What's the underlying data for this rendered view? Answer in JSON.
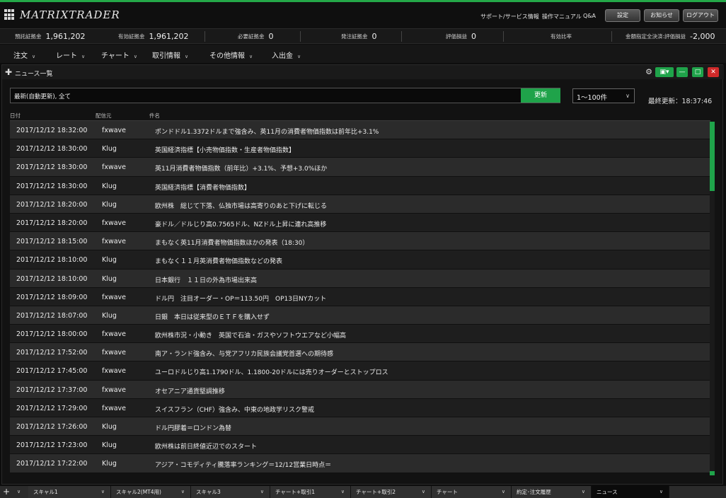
{
  "header": {
    "logo_text": "MATRIXTRADER",
    "links": [
      "サポート/サービス情報",
      "操作マニュアル",
      "Q&A"
    ],
    "buttons": [
      "設定",
      "お知らせ",
      "ログアウト"
    ]
  },
  "account": [
    {
      "label": "預託証拠金",
      "value": "1,961,202"
    },
    {
      "label": "有効証拠金",
      "value": "1,961,202"
    },
    {
      "label": "必要証拠金",
      "value": "0"
    },
    {
      "label": "発注証拠金",
      "value": "0"
    },
    {
      "label": "評価損益",
      "value": "0"
    },
    {
      "label": "有効比率",
      "value": ""
    },
    {
      "label": "金額指定全決済:評価損益",
      "value": "-2,000"
    }
  ],
  "menu": [
    "注文",
    "レート",
    "チャート",
    "取引情報",
    "その他情報",
    "入出金"
  ],
  "panel": {
    "title": "ニュース一覧",
    "filter_text": "最新(自動更新), 全て",
    "refresh_label": "更新",
    "range_value": "1～100件",
    "last_update": "最終更新：18:37:46",
    "columns": {
      "date": "日付",
      "source": "配信元",
      "subject": "件名"
    }
  },
  "news": [
    {
      "date": "2017/12/12 18:32:00",
      "source": "fxwave",
      "title": "ポンドドル1.3372ドルまで強含み、英11月の消費者物価指数は前年比+3.1%"
    },
    {
      "date": "2017/12/12 18:30:00",
      "source": "Klug",
      "title": "英国経済指標【小売物価指数・生産者物価指数】"
    },
    {
      "date": "2017/12/12 18:30:00",
      "source": "fxwave",
      "title": "英11月消費者物価指数（前年比）+3.1%、予想+3.0%ほか"
    },
    {
      "date": "2017/12/12 18:30:00",
      "source": "Klug",
      "title": "英国経済指標【消費者物価指数】"
    },
    {
      "date": "2017/12/12 18:20:00",
      "source": "Klug",
      "title": "欧州株　総じて下落、仏独市場は高寄りのあと下げに転じる"
    },
    {
      "date": "2017/12/12 18:20:00",
      "source": "fxwave",
      "title": "豪ドル／ドルじり高0.7565ドル、NZドル上昇に連れ高推移"
    },
    {
      "date": "2017/12/12 18:15:00",
      "source": "fxwave",
      "title": "まもなく英11月消費者物価指数ほかの発表（18:30）"
    },
    {
      "date": "2017/12/12 18:10:00",
      "source": "Klug",
      "title": "まもなく１１月英消費者物価指数などの発表"
    },
    {
      "date": "2017/12/12 18:10:00",
      "source": "Klug",
      "title": "日本銀行　１１日の外為市場出来高"
    },
    {
      "date": "2017/12/12 18:09:00",
      "source": "fxwave",
      "title": "ドル円　注目オーダー・OP＝113.50円　OP13日NYカット"
    },
    {
      "date": "2017/12/12 18:07:00",
      "source": "Klug",
      "title": "日銀　本日は従来型のＥＴＦを購入せず"
    },
    {
      "date": "2017/12/12 18:00:00",
      "source": "fxwave",
      "title": "欧州株市況・小動き　英国で石油・ガスやソフトウエアなど小幅高"
    },
    {
      "date": "2017/12/12 17:52:00",
      "source": "fxwave",
      "title": "南ア・ランド強含み、与党アフリカ民族会議党首選への期待感"
    },
    {
      "date": "2017/12/12 17:45:00",
      "source": "fxwave",
      "title": "ユーロドルじり高1.1790ドル、1.1800-20ドルには売りオーダーとストップロス"
    },
    {
      "date": "2017/12/12 17:37:00",
      "source": "fxwave",
      "title": "オセアニア通貨堅調推移"
    },
    {
      "date": "2017/12/12 17:29:00",
      "source": "fxwave",
      "title": "スイスフラン（CHF）強含み、中東の地政学リスク警戒"
    },
    {
      "date": "2017/12/12 17:26:00",
      "source": "Klug",
      "title": "ドル円膠着＝ロンドン為替"
    },
    {
      "date": "2017/12/12 17:23:00",
      "source": "Klug",
      "title": "欧州株は前日終値近辺でのスタート"
    },
    {
      "date": "2017/12/12 17:22:00",
      "source": "Klug",
      "title": "アジア・コモディティ騰落率ランキング＝12/12営業日時点＝"
    }
  ],
  "tabs": [
    "スキャル1",
    "スキャル2(MT4用)",
    "スキャル3",
    "チャート+取引1",
    "チャート+取引2",
    "チャート",
    "約定･注文履歴",
    "ニュース"
  ],
  "colors": {
    "accent": "#1fa34a"
  }
}
